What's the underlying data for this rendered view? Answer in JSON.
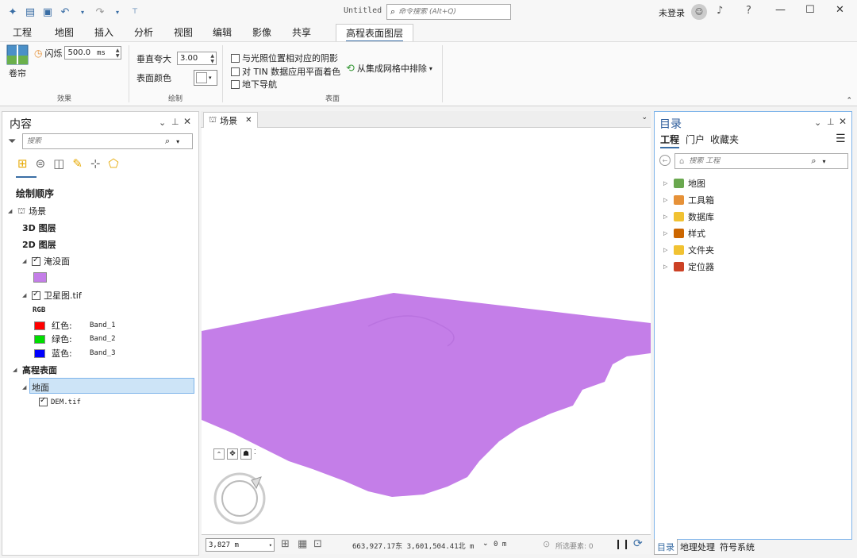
{
  "titlebar": {
    "doc_title": "Untitled",
    "command_search_placeholder": "命令搜索 (Alt+Q)",
    "user": "未登录",
    "help": "?"
  },
  "tabs": [
    "工程",
    "地图",
    "插入",
    "分析",
    "视图",
    "编辑",
    "影像",
    "共享",
    "高程表面图层"
  ],
  "ribbon": {
    "swipe_label": "卷帘",
    "flash_label": "闪烁",
    "flash_value": "500.0",
    "flash_unit": "ms",
    "effects_group": "效果",
    "vertical_exaggeration_label": "垂直夸大",
    "vertical_exaggeration_value": "3.00",
    "surface_color_label": "表面颜色",
    "draw_group": "绘制",
    "shade_relative_light": "与光照位置相对应的阴影",
    "tin_shade": "对 TIN 数据应用平面着色",
    "underground_nav": "地下导航",
    "exclude_from_mosaic": "从集成网格中排除",
    "surface_group": "表面"
  },
  "contents": {
    "title": "内容",
    "search_placeholder": "搜索",
    "drawing_order": "绘制顺序",
    "scene": "场景",
    "layers_3d": "3D 图层",
    "layers_2d": "2D 图层",
    "flood_layer": "淹没面",
    "flood_color": "#c47ee8",
    "satellite_layer": "卫星图.tif",
    "rgb": "RGB",
    "bands": [
      {
        "label": "红色:",
        "band": "Band_1",
        "color": "#ff0000"
      },
      {
        "label": "绿色:",
        "band": "Band_2",
        "color": "#00dd00"
      },
      {
        "label": "蓝色:",
        "band": "Band_3",
        "color": "#0000ff"
      }
    ],
    "elevation_surfaces": "高程表面",
    "ground": "地面",
    "dem": "DEM.tif"
  },
  "view": {
    "tab_label": "场景",
    "scale": "3,827 m",
    "coords": "663,927.17东 3,601,504.41北 m",
    "elevation": "0 m",
    "selected": "所选要素: 0"
  },
  "catalog": {
    "title": "目录",
    "tabs": [
      "工程",
      "门户",
      "收藏夹"
    ],
    "search_placeholder": "搜索 工程",
    "items": [
      {
        "label": "地图",
        "icon_color": "#6aa84f"
      },
      {
        "label": "工具箱",
        "icon_color": "#e69138"
      },
      {
        "label": "数据库",
        "icon_color": "#f1c232"
      },
      {
        "label": "样式",
        "icon_color": "#cc6600"
      },
      {
        "label": "文件夹",
        "icon_color": "#f1c232"
      },
      {
        "label": "定位器",
        "icon_color": "#cc4125"
      }
    ]
  },
  "bottom_tabs": [
    "目录",
    "地理处理",
    "符号系统"
  ]
}
